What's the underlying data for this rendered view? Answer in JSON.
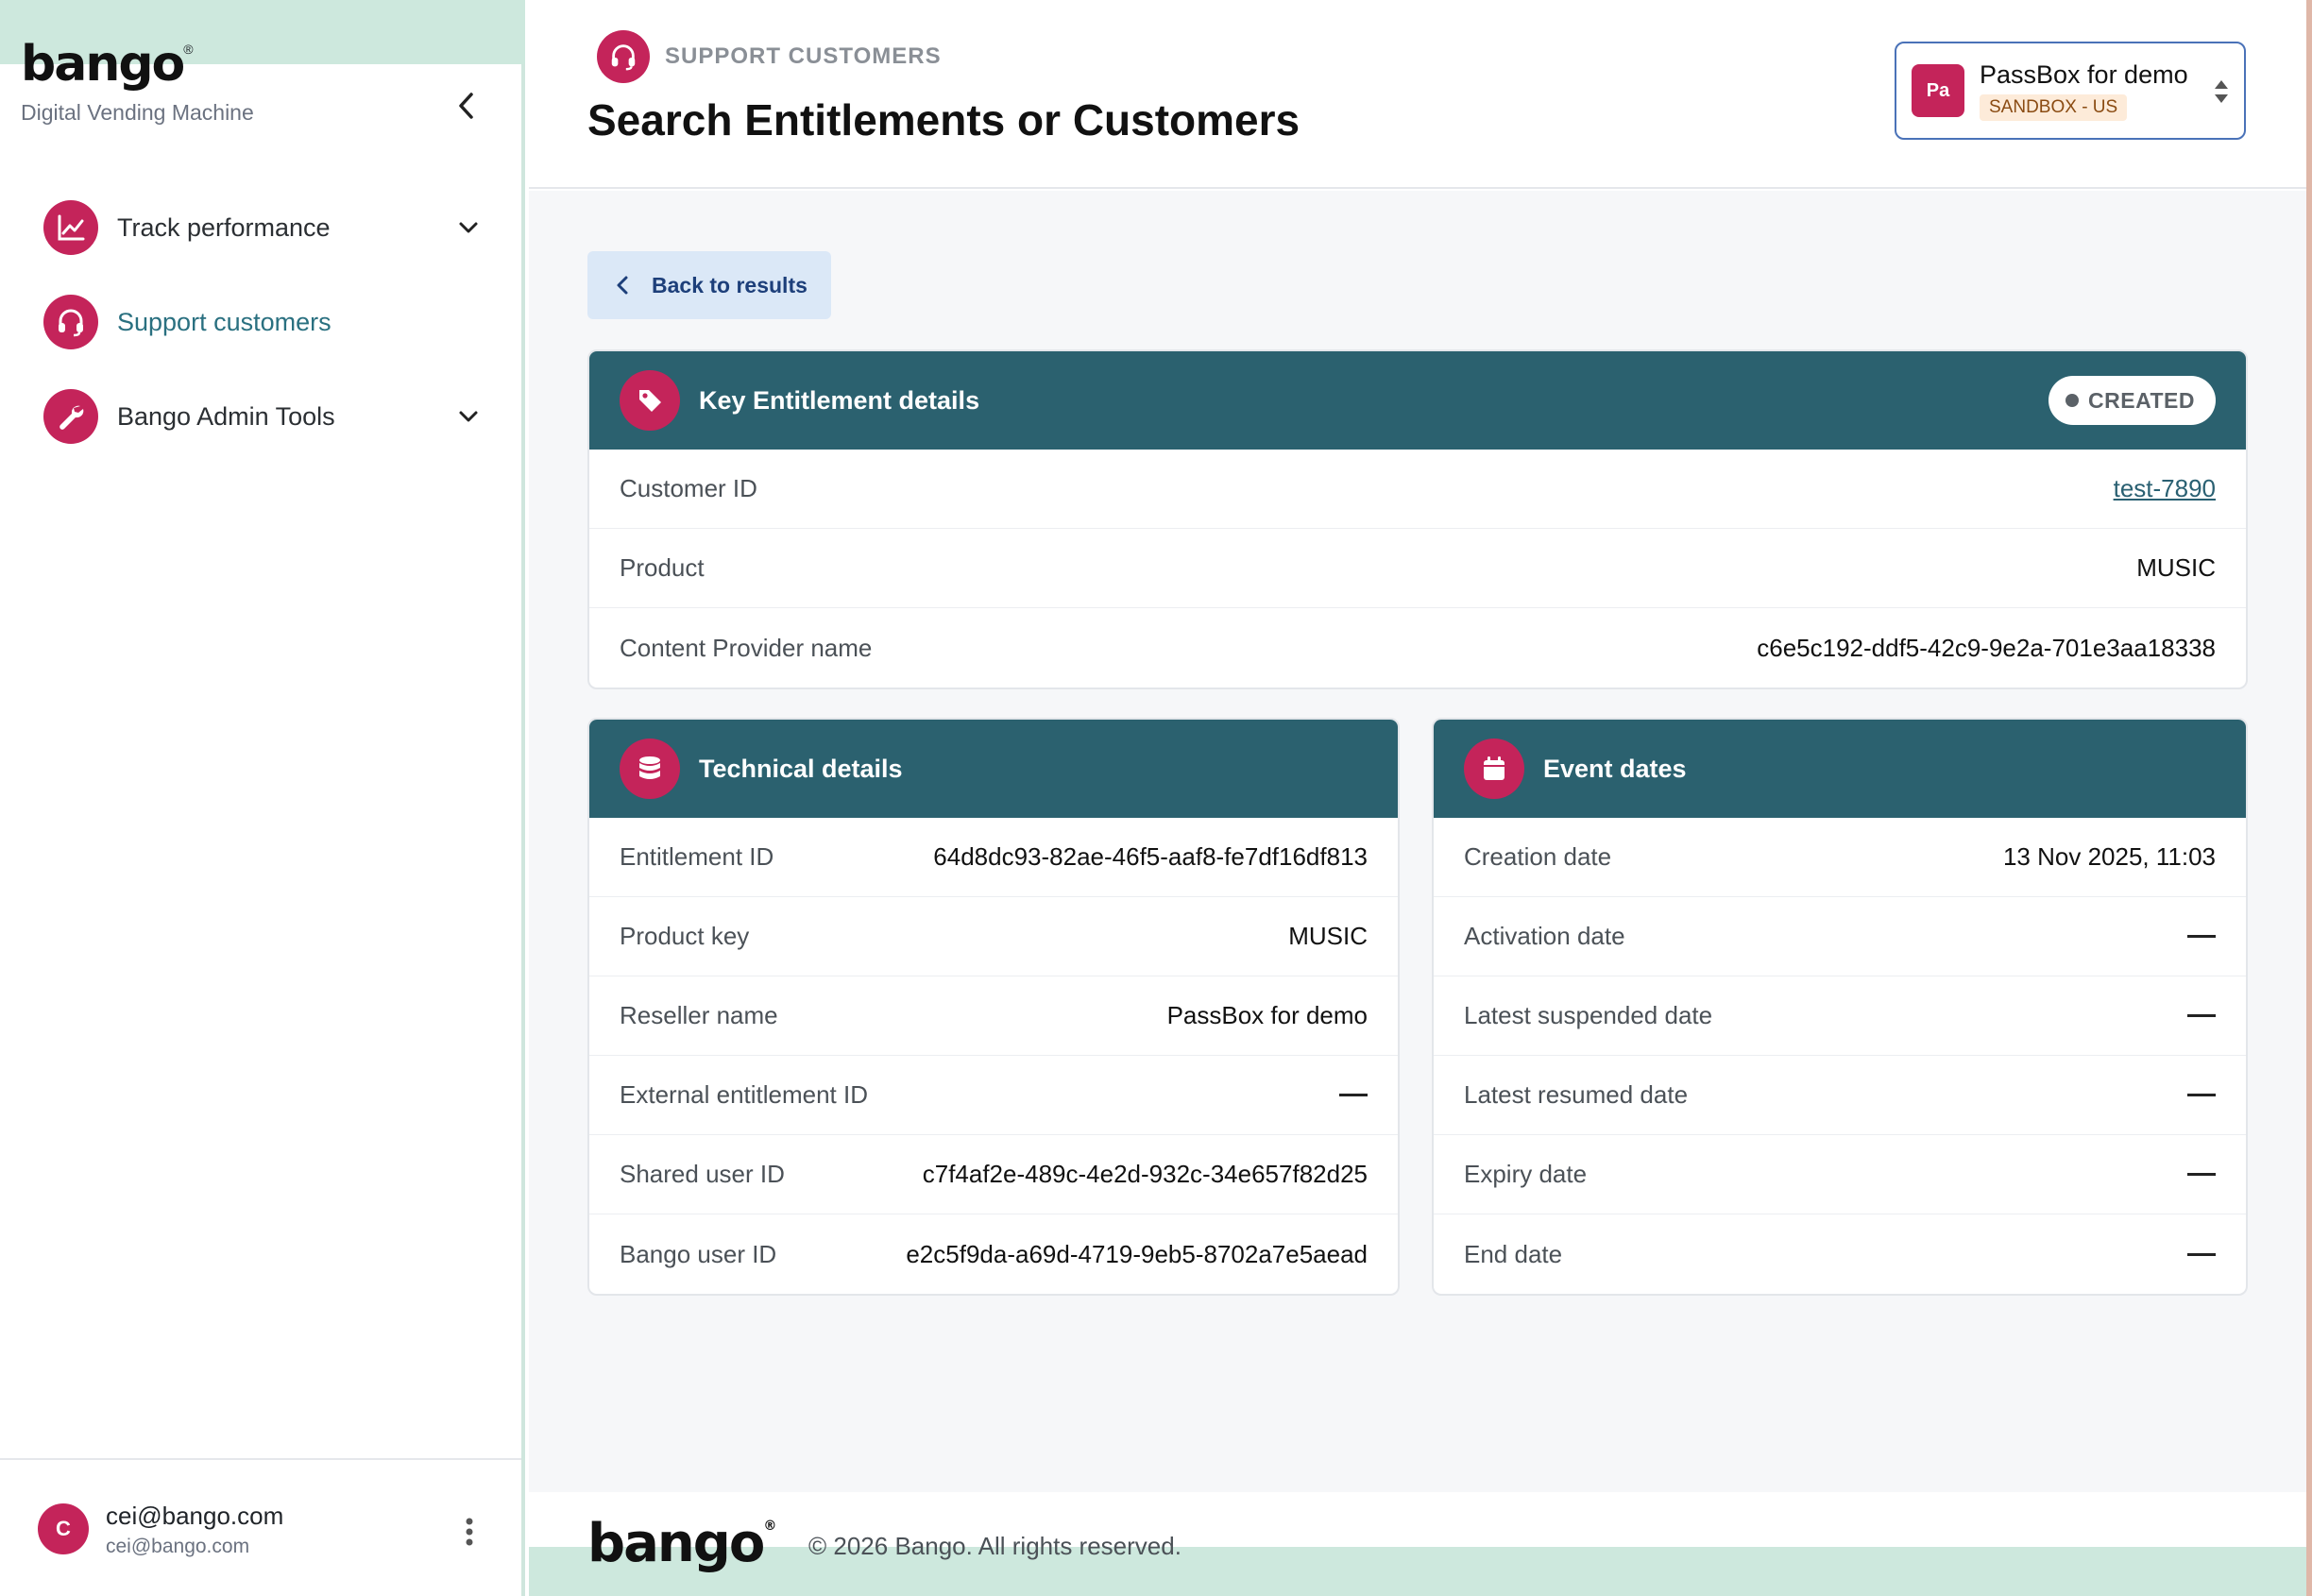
{
  "brand": {
    "logo": "bango",
    "logo_mark": "®",
    "subtitle": "Digital Vending Machine"
  },
  "sidebar": {
    "items": [
      {
        "label": "Track performance",
        "icon": "chart-line-icon"
      },
      {
        "label": "Support customers",
        "icon": "headset-icon",
        "active": true
      },
      {
        "label": "Bango Admin Tools",
        "icon": "wrench-icon"
      }
    ]
  },
  "user": {
    "initial": "C",
    "name": "cei@bango.com",
    "email": "cei@bango.com"
  },
  "header": {
    "breadcrumb": "SUPPORT CUSTOMERS",
    "title": "Search Entitlements or Customers",
    "tenant": {
      "initials": "Pa",
      "name": "PassBox for demo",
      "environment": "SANDBOX - US"
    }
  },
  "main": {
    "back_label": "Back to results",
    "key_details": {
      "title": "Key Entitlement details",
      "status": "CREATED",
      "rows": [
        {
          "label": "Customer ID",
          "value": "test-7890"
        },
        {
          "label": "Product",
          "value": "MUSIC"
        },
        {
          "label": "Content Provider name",
          "value": "c6e5c192-ddf5-42c9-9e2a-701e3aa18338"
        }
      ]
    },
    "technical": {
      "title": "Technical details",
      "rows": [
        {
          "label": "Entitlement ID",
          "value": "64d8dc93-82ae-46f5-aaf8-fe7df16df813"
        },
        {
          "label": "Product key",
          "value": "MUSIC"
        },
        {
          "label": "Reseller name",
          "value": "PassBox for demo"
        },
        {
          "label": "External entitlement ID",
          "value": ""
        },
        {
          "label": "Shared user ID",
          "value": "c7f4af2e-489c-4e2d-932c-34e657f82d25"
        },
        {
          "label": "Bango user ID",
          "value": "e2c5f9da-a69d-4719-9eb5-8702a7e5aead"
        }
      ]
    },
    "events": {
      "title": "Event dates",
      "rows": [
        {
          "label": "Creation date",
          "value": "13 Nov 2025, 11:03"
        },
        {
          "label": "Activation date",
          "value": ""
        },
        {
          "label": "Latest suspended date",
          "value": ""
        },
        {
          "label": "Latest resumed date",
          "value": ""
        },
        {
          "label": "Expiry date",
          "value": ""
        },
        {
          "label": "End date",
          "value": ""
        }
      ]
    }
  },
  "footer": {
    "logo": "bango",
    "logo_mark": "®",
    "copyright": "© 2026 Bango. All rights reserved."
  },
  "colors": {
    "accent": "#c4245a",
    "card_header": "#2b616f",
    "mint": "#cde8dd",
    "link": "#2a6072"
  }
}
